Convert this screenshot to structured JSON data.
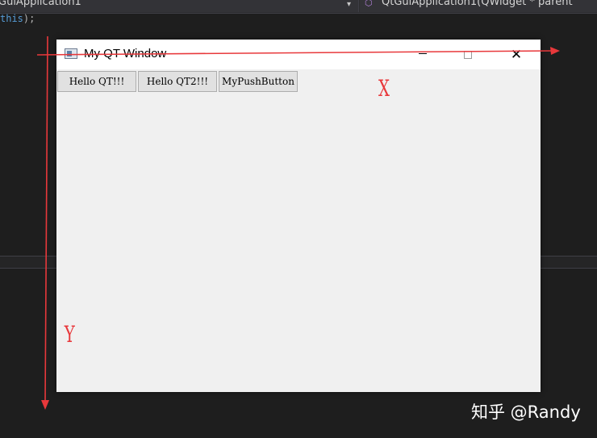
{
  "ide": {
    "left_dropdown": "GuiApplication1",
    "right_dropdown": "QtGuiApplication1(QWidget * parent",
    "code_line": {
      "keyword": "this",
      "rest": ");"
    }
  },
  "qt_window": {
    "title": "My QT Window",
    "buttons": [
      "Hello QT!!!",
      "Hello QT2!!!",
      "MyPushButton"
    ]
  },
  "annotations": {
    "x_label": "X",
    "y_label": "Y",
    "arrow_color": "#e8383b"
  },
  "watermark": "知乎 @Randy"
}
